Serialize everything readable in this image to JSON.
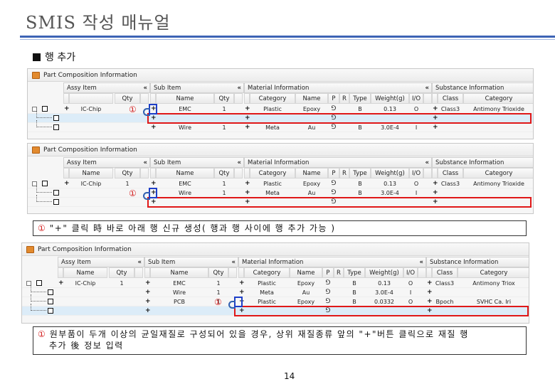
{
  "page_title": "SMIS 작성 매뉴얼",
  "section_heading": "행 추가",
  "panel_title": "Part Composition Information",
  "marker": "①",
  "expand_glyph": "⊟",
  "tool_glyph": "⅁",
  "plus_glyph": "+",
  "group_headers": {
    "assy": "Assy Item",
    "sub": "Sub Item",
    "material": "Material Information",
    "substance": "Substance Information",
    "collapse": "«"
  },
  "columns": {
    "name": "Name",
    "qty": "Qty",
    "category": "Category",
    "p": "P",
    "r": "R",
    "type": "Type",
    "weight": "Weight(g)",
    "io": "I/O",
    "class": "Class"
  },
  "panel1": {
    "rows": [
      {
        "assy_name": "IC-Chip",
        "assy_qty": "",
        "sub_name": "EMC",
        "sub_qty": "1",
        "mat_cat": "Plastic",
        "mat_name": "Epoxy",
        "type": "B",
        "weight": "0.13",
        "io": "O",
        "sub_class": "Class3",
        "sub_cat": "Antimony Trioxide"
      },
      {
        "assy_name": "",
        "assy_qty": "",
        "sub_name": "",
        "sub_qty": "",
        "mat_cat": "",
        "mat_name": "",
        "type": "",
        "weight": "",
        "io": "",
        "sub_class": "",
        "sub_cat": ""
      },
      {
        "assy_name": "",
        "assy_qty": "",
        "sub_name": "Wire",
        "sub_qty": "1",
        "mat_cat": "Meta",
        "mat_name": "Au",
        "type": "B",
        "weight": "3.0E-4",
        "io": "I",
        "sub_class": "",
        "sub_cat": ""
      }
    ]
  },
  "panel2": {
    "rows": [
      {
        "assy_name": "IC-Chip",
        "assy_qty": "1",
        "sub_name": "EMC",
        "sub_qty": "1",
        "mat_cat": "Plastic",
        "mat_name": "Epoxy",
        "type": "B",
        "weight": "0.13",
        "io": "O",
        "sub_class": "Class3",
        "sub_cat": "Antimony Trioxide"
      },
      {
        "assy_name": "",
        "assy_qty": "",
        "sub_name": "Wire",
        "sub_qty": "1",
        "mat_cat": "Meta",
        "mat_name": "Au",
        "type": "B",
        "weight": "3.0E-4",
        "io": "I",
        "sub_class": "",
        "sub_cat": ""
      },
      {
        "assy_name": "",
        "assy_qty": "",
        "sub_name": "",
        "sub_qty": "",
        "mat_cat": "",
        "mat_name": "",
        "type": "",
        "weight": "",
        "io": "",
        "sub_class": "",
        "sub_cat": ""
      }
    ]
  },
  "panel3": {
    "rows": [
      {
        "assy_name": "IC-Chip",
        "assy_qty": "1",
        "sub_name": "EMC",
        "sub_qty": "1",
        "mat_cat": "Plastic",
        "mat_name": "Epoxy",
        "type": "B",
        "weight": "0.13",
        "io": "O",
        "sub_class": "Class3",
        "sub_cat": "Antimony Triox"
      },
      {
        "assy_name": "",
        "assy_qty": "",
        "sub_name": "Wire",
        "sub_qty": "1",
        "mat_cat": "Meta",
        "mat_name": "Au",
        "type": "B",
        "weight": "3.0E-4",
        "io": "I",
        "sub_class": "",
        "sub_cat": ""
      },
      {
        "assy_name": "",
        "assy_qty": "",
        "sub_name": "PCB",
        "sub_qty": "1",
        "mat_cat": "Plastic",
        "mat_name": "Epoxy",
        "type": "B",
        "weight": "0.0332",
        "io": "O",
        "sub_class": "Bpoch",
        "sub_cat": "SVHC Ca. Iri"
      },
      {
        "assy_name": "",
        "assy_qty": "",
        "sub_name": "",
        "sub_qty": "",
        "mat_cat": "",
        "mat_name": "",
        "type": "",
        "weight": "",
        "io": "",
        "sub_class": "",
        "sub_cat": ""
      }
    ]
  },
  "note1": "\"+\" 클릭 時 바로 아래 행 신규 생성( 행과 행 사이에 행 추가 가능 )",
  "note2_line1": "원부품이 두개 이상의 균일재질로 구성되어 있을 경우, 상위 재질종류 앞의 \"+\"버튼 클릭으로 재질 행",
  "note2_line2": "추가 後 정보 입력",
  "page_number": "14",
  "colors": {
    "accent": "#3d63b5",
    "highlight_red": "#e01818",
    "highlight_blue": "#1e3fc8",
    "selected_row": "#dcecf8"
  }
}
